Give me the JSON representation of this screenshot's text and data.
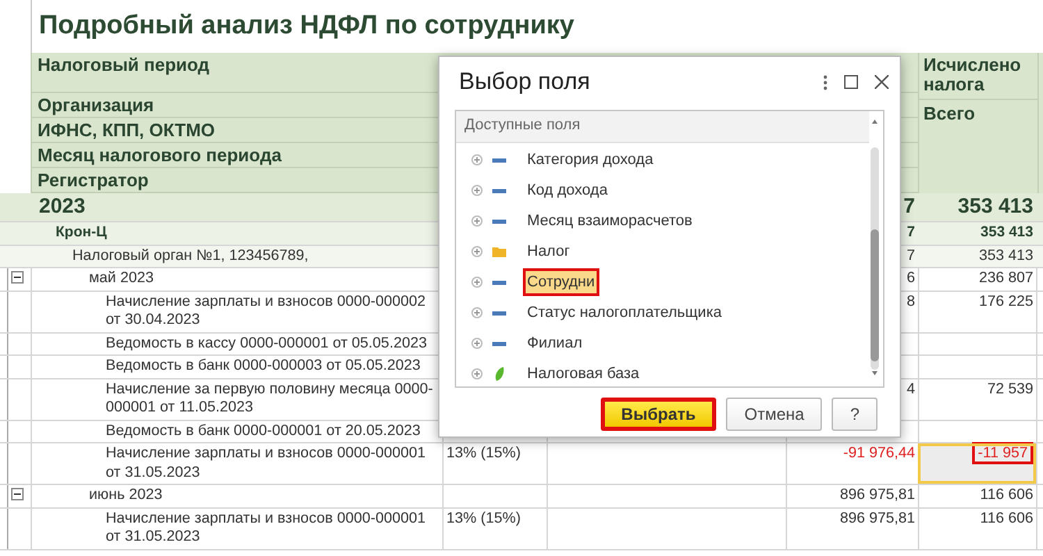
{
  "report": {
    "title": "Подробный анализ НДФЛ по сотруднику",
    "header_rows": [
      {
        "label": "Налоговый период"
      },
      {
        "label": "Организация"
      },
      {
        "label": "ИФНС, КПП, ОКТМО"
      },
      {
        "label": "Месяц налогового периода"
      },
      {
        "label": "Регистратор"
      }
    ],
    "tax_column": {
      "title": "Исчислено налога",
      "subtitle": "Всего"
    },
    "rows": [
      {
        "kind": "year",
        "label": "2023",
        "amount": "7",
        "tax": "353 413",
        "children": [
          {
            "kind": "organization",
            "label": "Крон-Ц",
            "amount": "7",
            "tax": "353 413",
            "children": [
              {
                "kind": "authority",
                "label": "Налоговый орган №1, 123456789,",
                "amount": "7",
                "tax": "353 413",
                "children": [
                  {
                    "kind": "month",
                    "label": "май 2023",
                    "expanded": true,
                    "amount": "6",
                    "tax": "236 807",
                    "children": [
                      {
                        "kind": "document",
                        "label": "Начисление зарплаты и взносов 0000-000002 от 30.04.2023",
                        "amount": "8",
                        "tax": "176 225"
                      },
                      {
                        "kind": "document",
                        "label": "Ведомость в кассу 0000-000001 от 05.05.2023"
                      },
                      {
                        "kind": "document",
                        "label": "Ведомость в банк 0000-000003 от 05.05.2023"
                      },
                      {
                        "kind": "document",
                        "label": "Начисление за первую половину месяца 0000-000001 от 11.05.2023",
                        "amount": "4",
                        "tax": "72 539"
                      },
                      {
                        "kind": "document",
                        "label": "Ведомость в банк 0000-000001 от 20.05.2023"
                      },
                      {
                        "kind": "document",
                        "label": "Начисление зарплаты и взносов 0000-000001 от 31.05.2023",
                        "rate": "13% (15%)",
                        "amount": "-91 976,44",
                        "tax": "-11 957",
                        "negative": true,
                        "selected": true,
                        "highlighted": true
                      }
                    ]
                  },
                  {
                    "kind": "month",
                    "label": "июнь 2023",
                    "expanded": true,
                    "amount": "896 975,81",
                    "tax": "116 606",
                    "children": [
                      {
                        "kind": "document",
                        "label": "Начисление зарплаты и взносов 0000-000001 от 31.05.2023",
                        "rate": "13% (15%)",
                        "amount": "896 975,81",
                        "tax": "116 606"
                      }
                    ]
                  }
                ]
              }
            ]
          }
        ]
      }
    ]
  },
  "dialog": {
    "title": "Выбор поля",
    "list_header": "Доступные поля",
    "items": [
      {
        "kind": "field",
        "label": "Категория дохода",
        "selected": false,
        "highlighted": false
      },
      {
        "kind": "field",
        "label": "Код дохода",
        "selected": false,
        "highlighted": false
      },
      {
        "kind": "field",
        "label": "Месяц взаиморасчетов",
        "selected": false,
        "highlighted": false
      },
      {
        "kind": "folder",
        "label": "Налог",
        "selected": false,
        "highlighted": false
      },
      {
        "kind": "field",
        "label": "Сотрудни",
        "selected": true,
        "highlighted": true
      },
      {
        "kind": "field",
        "label": "Статус налогоплательщика",
        "selected": false,
        "highlighted": false
      },
      {
        "kind": "field",
        "label": "Филиал",
        "selected": false,
        "highlighted": false
      },
      {
        "kind": "resource",
        "label": "Налоговая база",
        "selected": false,
        "highlighted": false
      }
    ],
    "buttons": [
      {
        "kind": "primary",
        "label": "Выбрать",
        "highlighted": true
      },
      {
        "kind": "default",
        "label": "Отмена",
        "highlighted": false
      },
      {
        "kind": "default",
        "label": "?",
        "highlighted": false
      }
    ]
  }
}
